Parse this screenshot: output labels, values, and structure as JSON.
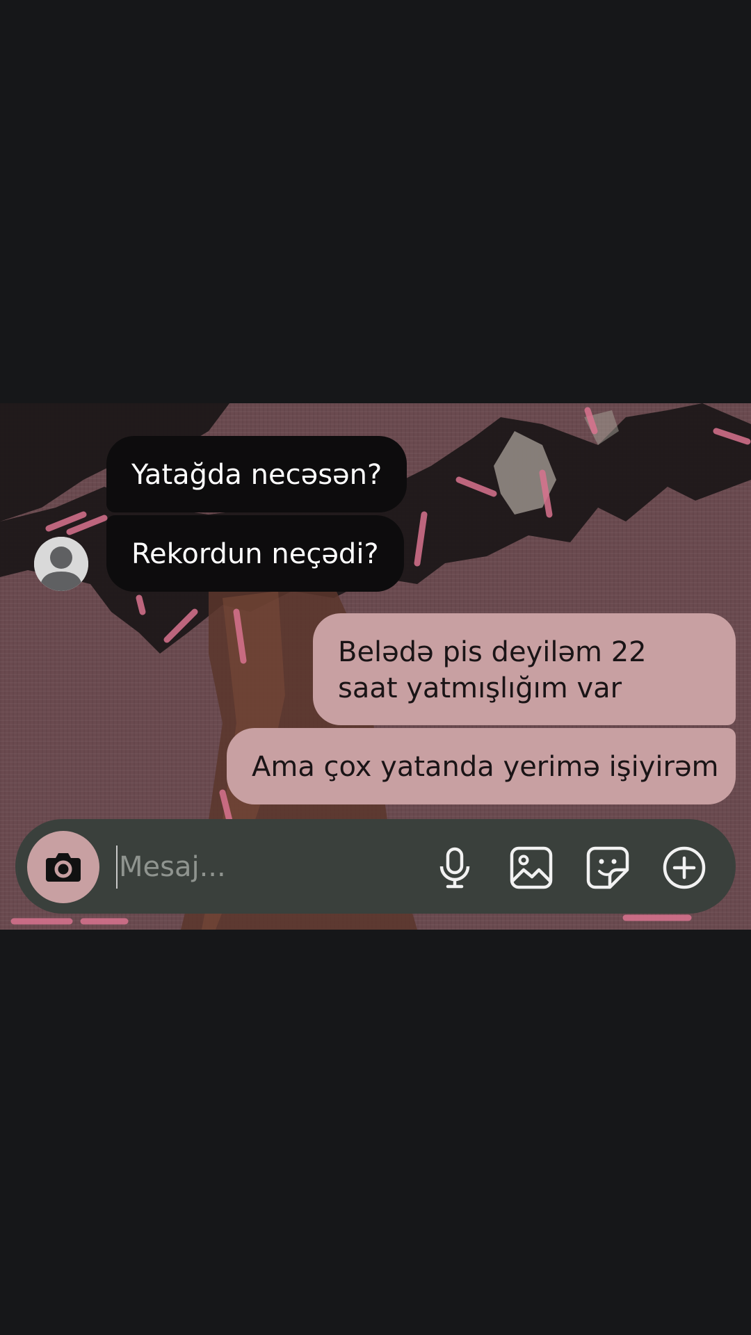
{
  "conversation": {
    "incoming": [
      {
        "text": "Yatağda necəsən?"
      },
      {
        "text": "Rekordun neçədi?"
      }
    ],
    "outgoing": [
      {
        "text": "Belədə pis deyiləm 22 saat yatmışlığım var"
      },
      {
        "text": "Ama çox yatanda yerimə işiyirəm"
      }
    ]
  },
  "composer": {
    "placeholder": "Mesaj...",
    "icons": [
      "camera-icon",
      "microphone-icon",
      "gallery-icon",
      "sticker-icon",
      "plus-icon"
    ]
  },
  "colors": {
    "page_background": "#161719",
    "incoming_bubble": "#0d0c0d",
    "outgoing_bubble": "#c8a0a2",
    "composer_background": "#3a403c",
    "accent_pink": "#c8a0a2"
  }
}
